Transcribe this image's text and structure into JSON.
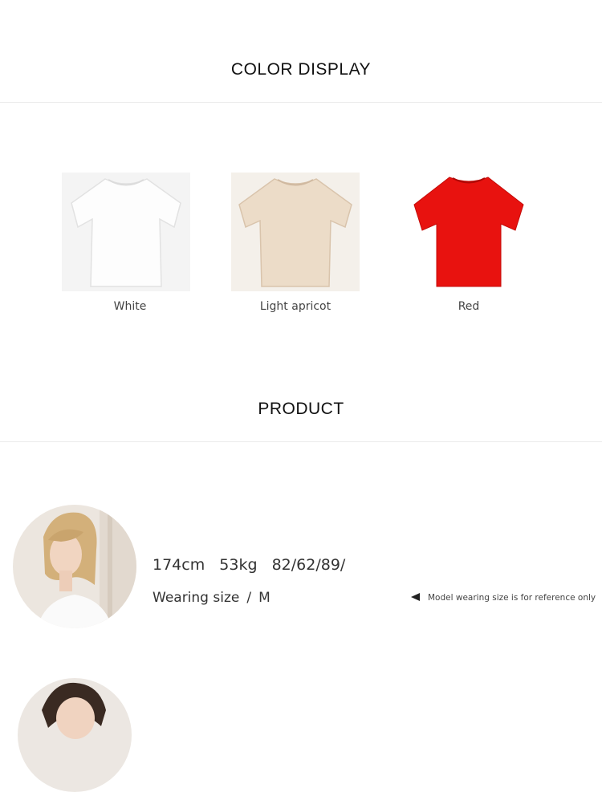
{
  "headings": {
    "color_display": "COLOR DISPLAY",
    "product": "PRODUCT"
  },
  "colors": [
    {
      "label": "White",
      "fill": "#fafafa",
      "shade": "#e6e6e6"
    },
    {
      "label": "Light apricot",
      "fill": "#ecdcc8",
      "shade": "#d9c4ac"
    },
    {
      "label": "Red",
      "fill": "#e8120f",
      "shade": "#c40b08"
    }
  ],
  "model": {
    "height": "174cm",
    "weight": "53kg",
    "measurements": "82/62/89/",
    "wearing_label": "Wearing size",
    "separator": "/",
    "wearing_size": "M",
    "note": "Model wearing size is for reference only"
  }
}
